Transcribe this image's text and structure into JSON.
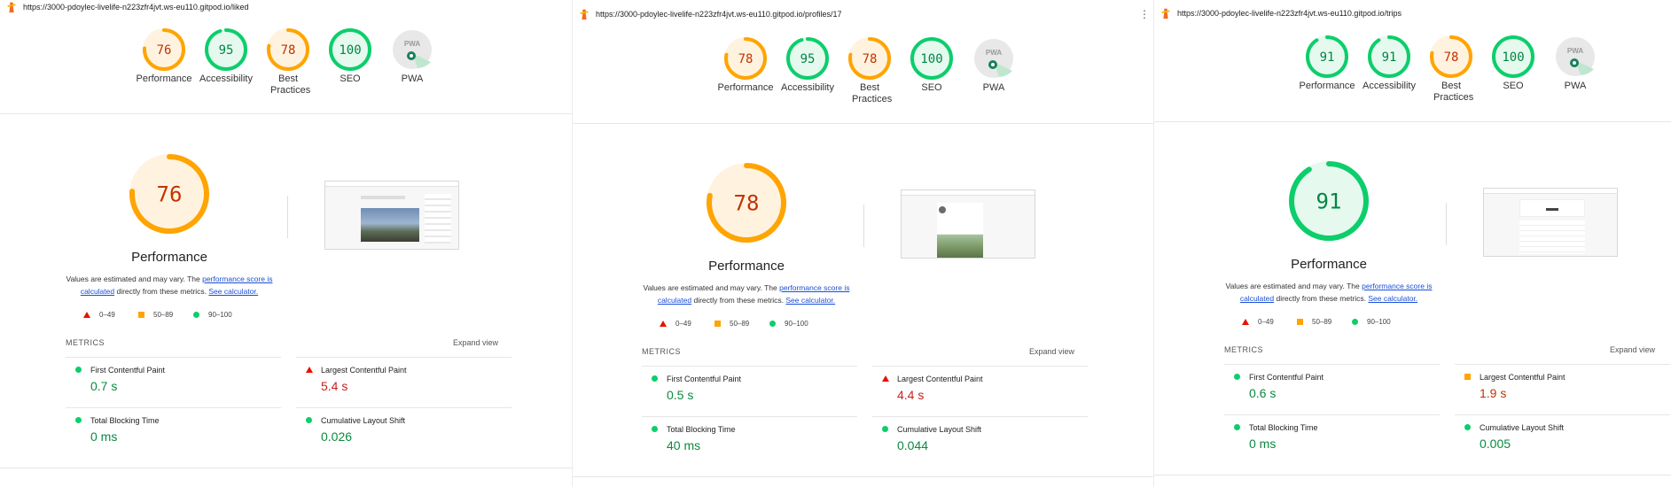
{
  "colors": {
    "pass": "#0cce6b",
    "average": "#ffa400",
    "fail": "#eb0f00",
    "pwa": "#9e9e9e",
    "link": "#1a4fd6"
  },
  "shared": {
    "desc_prefix": "Values are estimated and may vary. The ",
    "desc_link1": "performance score is calculated",
    "desc_middle": " directly from these metrics. ",
    "desc_link2": "See calculator.",
    "legend": [
      "0–49",
      "50–89",
      "90–100"
    ],
    "metrics_title": "METRICS",
    "expand": "Expand view",
    "perf_label": "Performance",
    "pwa_text": "PWA"
  },
  "reports": [
    {
      "url": "https://3000-pdoylec-livelife-n223zfr4jvt.ws-eu110.gitpod.io/liked",
      "gauges": [
        {
          "label": "Performance",
          "score": "76",
          "value": 76,
          "status": "average"
        },
        {
          "label": "Accessibility",
          "score": "95",
          "value": 95,
          "status": "pass"
        },
        {
          "label": "Best Practices",
          "score": "78",
          "value": 78,
          "status": "average"
        },
        {
          "label": "SEO",
          "score": "100",
          "value": 100,
          "status": "pass"
        },
        {
          "label": "PWA",
          "score": "",
          "value": 0,
          "status": "pwa"
        }
      ],
      "big_score": "76",
      "big_value": 76,
      "big_status": "average",
      "metrics": [
        {
          "name": "First Contentful Paint",
          "value": "0.7 s",
          "status": "pass"
        },
        {
          "name": "Largest Contentful Paint",
          "value": "5.4 s",
          "status": "fail"
        },
        {
          "name": "Total Blocking Time",
          "value": "0 ms",
          "status": "pass"
        },
        {
          "name": "Cumulative Layout Shift",
          "value": "0.026",
          "status": "pass"
        }
      ]
    },
    {
      "url": "https://3000-pdoylec-livelife-n223zfr4jvt.ws-eu110.gitpod.io/profiles/17",
      "gauges": [
        {
          "label": "Performance",
          "score": "78",
          "value": 78,
          "status": "average"
        },
        {
          "label": "Accessibility",
          "score": "95",
          "value": 95,
          "status": "pass"
        },
        {
          "label": "Best Practices",
          "score": "78",
          "value": 78,
          "status": "average"
        },
        {
          "label": "SEO",
          "score": "100",
          "value": 100,
          "status": "pass"
        },
        {
          "label": "PWA",
          "score": "",
          "value": 0,
          "status": "pwa"
        }
      ],
      "big_score": "78",
      "big_value": 78,
      "big_status": "average",
      "metrics": [
        {
          "name": "First Contentful Paint",
          "value": "0.5 s",
          "status": "pass"
        },
        {
          "name": "Largest Contentful Paint",
          "value": "4.4 s",
          "status": "fail"
        },
        {
          "name": "Total Blocking Time",
          "value": "40 ms",
          "status": "pass"
        },
        {
          "name": "Cumulative Layout Shift",
          "value": "0.044",
          "status": "pass"
        }
      ]
    },
    {
      "url": "https://3000-pdoylec-livelife-n223zfr4jvt.ws-eu110.gitpod.io/trips",
      "gauges": [
        {
          "label": "Performance",
          "score": "91",
          "value": 91,
          "status": "pass"
        },
        {
          "label": "Accessibility",
          "score": "91",
          "value": 91,
          "status": "pass"
        },
        {
          "label": "Best Practices",
          "score": "78",
          "value": 78,
          "status": "average"
        },
        {
          "label": "SEO",
          "score": "100",
          "value": 100,
          "status": "pass"
        },
        {
          "label": "PWA",
          "score": "",
          "value": 0,
          "status": "pwa"
        }
      ],
      "big_score": "91",
      "big_value": 91,
      "big_status": "pass",
      "metrics": [
        {
          "name": "First Contentful Paint",
          "value": "0.6 s",
          "status": "pass"
        },
        {
          "name": "Largest Contentful Paint",
          "value": "1.9 s",
          "status": "average"
        },
        {
          "name": "Total Blocking Time",
          "value": "0 ms",
          "status": "pass"
        },
        {
          "name": "Cumulative Layout Shift",
          "value": "0.005",
          "status": "pass"
        }
      ]
    }
  ]
}
